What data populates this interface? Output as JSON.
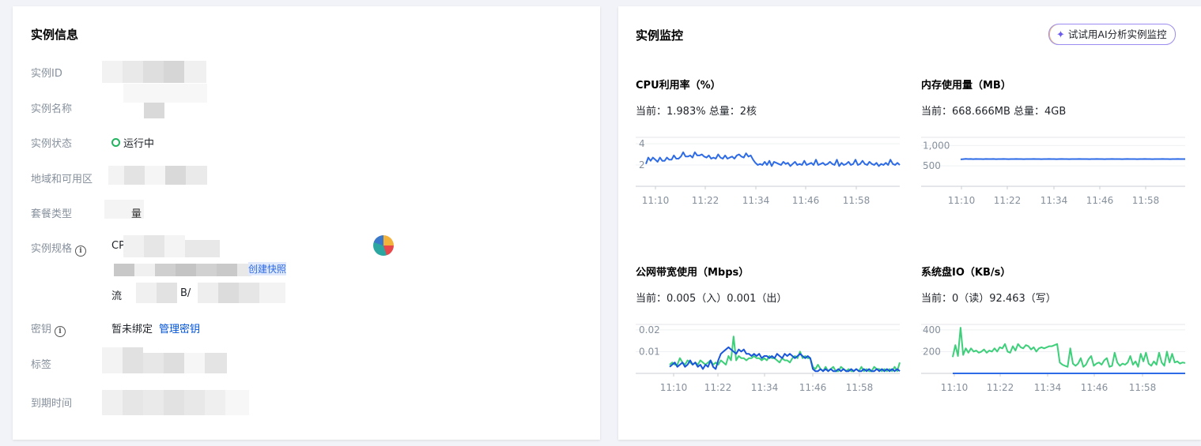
{
  "info": {
    "title": "实例信息",
    "rows": {
      "id": {
        "label": "实例ID"
      },
      "name": {
        "label": "实例名称"
      },
      "status": {
        "label": "实例状态",
        "value": "运行中",
        "color": "#22b35e"
      },
      "region": {
        "label": "地域和可用区"
      },
      "plan": {
        "label": "套餐类型",
        "value": "量"
      },
      "spec": {
        "label": "实例规格",
        "line1": "CP",
        "line2_link": "创建快照",
        "line3_prefix": "流",
        "line3_mid": "B/"
      },
      "key": {
        "label": "密钥",
        "value": "暂未绑定",
        "link": "管理密钥"
      },
      "tags": {
        "label": "标签"
      },
      "expire": {
        "label": "到期时间"
      }
    }
  },
  "monitor": {
    "title": "实例监控",
    "ai_button": "试试用AI分析实例监控",
    "ai_icon": "sparkle-icon"
  },
  "chart_data": [
    {
      "type": "line",
      "title": "CPU利用率（%）",
      "summary": "当前：1.983% 总量：2核",
      "x_ticks": [
        "11:10",
        "11:22",
        "11:34",
        "11:46",
        "11:58"
      ],
      "y_ticks": [
        "4",
        "2"
      ],
      "y_tick_values": [
        4,
        2
      ],
      "ylim": [
        0,
        4.6
      ],
      "grid": true,
      "series": [
        {
          "color": "#2e6be6",
          "values": [
            2.1,
            2.7,
            2.4,
            2.7,
            2.5,
            2.3,
            2.7,
            2.4,
            2.4,
            2.7,
            2.5,
            2.5,
            2.9,
            2.6,
            2.6,
            2.8,
            3.2,
            2.8,
            2.8,
            2.9,
            2.7,
            3.2,
            2.9,
            2.9,
            3.0,
            2.8,
            2.7,
            2.9,
            2.6,
            2.7,
            2.6,
            3.0,
            2.7,
            2.6,
            2.9,
            2.6,
            2.7,
            2.8,
            2.6,
            2.9,
            3.0,
            2.8,
            2.7,
            3.1,
            2.8,
            2.9,
            2.5,
            2.2,
            2.0,
            2.1,
            2.0,
            2.3,
            2.0,
            2.4,
            1.9,
            2.3,
            2.2,
            2.1,
            2.0,
            2.3,
            2.1,
            2.2,
            1.9,
            2.1,
            2.3,
            2.0,
            2.1,
            2.0,
            2.4,
            2.0,
            2.1,
            2.2,
            2.0,
            2.5,
            2.0,
            2.1,
            2.2,
            2.0,
            2.1,
            2.3,
            2.1,
            2.0,
            2.5,
            1.9,
            2.2,
            2.0,
            2.1,
            2.3,
            2.0,
            2.1,
            2.5,
            2.0,
            2.1,
            2.4,
            2.1,
            2.0,
            2.3,
            2.1,
            2.0,
            2.2,
            1.9,
            2.1,
            2.0,
            2.2,
            2.0,
            2.5,
            2.1,
            2.0,
            2.2,
            2.0
          ]
        }
      ]
    },
    {
      "type": "line",
      "title": "内存使用量（MB）",
      "summary": "当前：668.666MB 总量：4GB",
      "x_ticks": [
        "11:10",
        "11:22",
        "11:34",
        "11:46",
        "11:58"
      ],
      "y_ticks": [
        "1,000",
        "500"
      ],
      "y_tick_values": [
        1000,
        500
      ],
      "ylim": [
        0,
        1200
      ],
      "grid": true,
      "series": [
        {
          "color": "#2e6be6",
          "values": [
            660,
            665,
            672,
            668,
            670,
            666,
            669,
            667,
            668,
            665,
            670,
            668,
            667,
            669,
            666,
            668,
            667,
            669,
            668,
            666,
            667,
            668,
            669,
            667,
            668,
            666,
            667,
            668,
            667,
            669,
            668,
            667,
            666,
            668,
            667,
            669,
            668,
            667,
            666,
            668,
            669,
            667,
            668,
            666,
            667,
            668,
            667,
            669,
            668,
            667,
            668,
            666,
            667,
            668,
            669,
            667,
            668,
            666,
            668,
            667,
            669,
            668,
            667,
            668,
            666,
            667,
            669,
            668,
            667,
            668,
            666,
            668,
            667,
            669,
            668,
            667,
            666,
            668,
            667,
            668,
            669,
            667,
            668,
            666,
            667,
            668,
            669,
            667,
            668,
            667
          ]
        }
      ]
    },
    {
      "type": "line",
      "title": "公网带宽使用（Mbps）",
      "summary": "当前：0.005（入）0.001（出）",
      "x_ticks": [
        "11:10",
        "11:22",
        "11:34",
        "11:46",
        "11:58"
      ],
      "y_ticks": [
        "0.02",
        "0.01"
      ],
      "y_tick_values": [
        0.02,
        0.01
      ],
      "ylim": [
        0,
        0.0225
      ],
      "grid": true,
      "series": [
        {
          "color": "#3ecf7a",
          "values": [
            0.004,
            0.005,
            0.004,
            0.004,
            0.007,
            0.005,
            0.004,
            0.006,
            0.005,
            0.004,
            0.005,
            0.004,
            0.006,
            0.005,
            0.004,
            0.005,
            0.006,
            0.004,
            0.005,
            0.004,
            0.006,
            0.005,
            0.004,
            0.008,
            0.006,
            0.017,
            0.006,
            0.008,
            0.007,
            0.007,
            0.006,
            0.007,
            0.007,
            0.008,
            0.007,
            0.007,
            0.006,
            0.007,
            0.006,
            0.008,
            0.007,
            0.007,
            0.006,
            0.005,
            0.007,
            0.006,
            0.006,
            0.005,
            0.007,
            0.008,
            0.007,
            0.01,
            0.007,
            0.008,
            0.007,
            0.007,
            0.003,
            0.002,
            0.004,
            0.002,
            0.001,
            0.003,
            0.001,
            0.002,
            0.003,
            0.001,
            0.001,
            0.003,
            0.002,
            0.001,
            0.002,
            0.001,
            0.001,
            0.002,
            0.001,
            0.003,
            0.001,
            0.002,
            0.001,
            0.001,
            0.003,
            0.002,
            0.002,
            0.001,
            0.002,
            0.001,
            0.002,
            0.001,
            0.003,
            0.001,
            0.005
          ]
        },
        {
          "color": "#1a56db",
          "values": [
            0.003,
            0.004,
            0.005,
            0.003,
            0.004,
            0.005,
            0.003,
            0.004,
            0.006,
            0.004,
            0.005,
            0.003,
            0.004,
            0.002,
            0.004,
            0.003,
            0.006,
            0.003,
            0.002,
            0.006,
            0.009,
            0.01,
            0.011,
            0.012,
            0.011,
            0.01,
            0.009,
            0.011,
            0.01,
            0.011,
            0.009,
            0.009,
            0.008,
            0.009,
            0.008,
            0.009,
            0.007,
            0.008,
            0.008,
            0.007,
            0.008,
            0.007,
            0.009,
            0.008,
            0.007,
            0.009,
            0.008,
            0.009,
            0.008,
            0.007,
            0.008,
            0.009,
            0.008,
            0.007,
            0.008,
            0.007,
            0.002,
            0.001,
            0.001,
            0.002,
            0.001,
            0.002,
            0.001,
            0.002,
            0.001,
            0.001,
            0.002,
            0.001,
            0.002,
            0.001,
            0.001,
            0.002,
            0.001,
            0.002,
            0.001,
            0.001,
            0.002,
            0.001,
            0.002,
            0.001,
            0.001,
            0.002,
            0.001,
            0.002,
            0.001,
            0.002,
            0.001,
            0.002,
            0.001,
            0.002,
            0.001
          ]
        }
      ]
    },
    {
      "type": "line",
      "title": "系统盘IO（KB/s）",
      "summary": "当前：0（读）92.463（写）",
      "x_ticks": [
        "11:10",
        "11:22",
        "11:34",
        "11:46",
        "11:58"
      ],
      "y_ticks": [
        "400",
        "200"
      ],
      "y_tick_values": [
        400,
        200
      ],
      "ylim": [
        0,
        450
      ],
      "grid": true,
      "series": [
        {
          "color": "#3ecf7a",
          "values": [
            150,
            260,
            160,
            420,
            170,
            230,
            190,
            230,
            200,
            210,
            190,
            200,
            220,
            190,
            210,
            200,
            230,
            200,
            240,
            230,
            270,
            200,
            190,
            250,
            210,
            270,
            240,
            230,
            260,
            250,
            220,
            240,
            200,
            230,
            240,
            230,
            240,
            250,
            250,
            260,
            270,
            100,
            80,
            70,
            60,
            230,
            90,
            70,
            90,
            140,
            60,
            80,
            130,
            160,
            70,
            90,
            100,
            80,
            120,
            140,
            60,
            70,
            190,
            100,
            70,
            90,
            80,
            100,
            160,
            80,
            110,
            60,
            180,
            110,
            190,
            90,
            70,
            110,
            80,
            190,
            100,
            70,
            200,
            100,
            180,
            100,
            110,
            90,
            100,
            95
          ]
        },
        {
          "color": "#2e6be6",
          "values": [
            0,
            0,
            0,
            0,
            0,
            0,
            0,
            0,
            0,
            0,
            0,
            0,
            0,
            0,
            0,
            0,
            0,
            0,
            0,
            0,
            0,
            0,
            0,
            0,
            0,
            0,
            0,
            0,
            0,
            0,
            0,
            0,
            0,
            0,
            0,
            0,
            0,
            0,
            0,
            0,
            0,
            0,
            0,
            0,
            0,
            0
          ]
        }
      ]
    }
  ]
}
